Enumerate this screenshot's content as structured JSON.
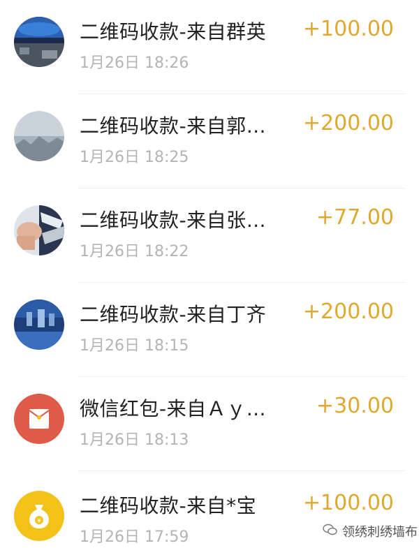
{
  "transactions": [
    {
      "title": "二维码收款-来自群英",
      "time": "1月26日 18:26",
      "amount": "+100.00",
      "avatar": "photo-night-scene"
    },
    {
      "title": "二维码收款-来自郭…",
      "time": "1月26日 18:25",
      "amount": "+200.00",
      "avatar": "photo-foggy-sky"
    },
    {
      "title": "二维码收款-来自张…",
      "time": "1月26日 18:22",
      "amount": "+77.00",
      "avatar": "photo-hand"
    },
    {
      "title": "二维码收款-来自丁齐",
      "time": "1月26日 18:15",
      "amount": "+200.00",
      "avatar": "photo-blue-scene"
    },
    {
      "title": "微信红包-来自Ａｙ…",
      "time": "1月26日 18:13",
      "amount": "+30.00",
      "avatar": "red-envelope-icon"
    },
    {
      "title": "二维码收款-来自*宝",
      "time": "1月26日 17:59",
      "amount": "+100.00",
      "avatar": "money-bag-icon"
    }
  ],
  "colors": {
    "amount": "#e0a82e",
    "title": "#222222",
    "time": "#b4b4b4",
    "red_envelope": "#e05a48",
    "money_bag": "#f2c21a"
  },
  "watermark": {
    "text": "领绣刺绣墙布",
    "icon": "wechat-icon"
  }
}
